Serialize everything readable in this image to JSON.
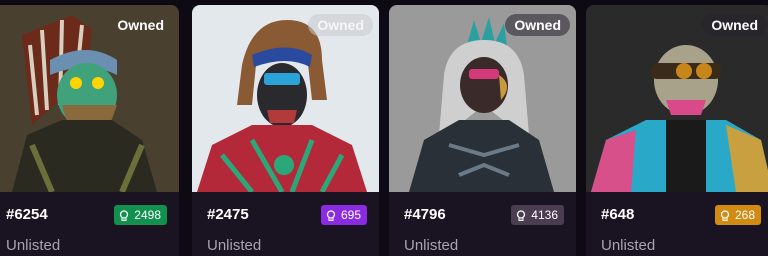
{
  "cards": [
    {
      "owned_label": "Owned",
      "id": "#6254",
      "rank": "2498",
      "rank_color": "#11904e",
      "status": "Unlisted"
    },
    {
      "owned_label": "Owned",
      "id": "#2475",
      "rank": "695",
      "rank_color": "#8a2be2",
      "status": "Unlisted"
    },
    {
      "owned_label": "Owned",
      "id": "#4796",
      "rank": "4136",
      "rank_color": "#4a3d52",
      "status": "Unlisted"
    },
    {
      "owned_label": "Owned",
      "id": "#648",
      "rank": "268",
      "rank_color": "#d18a12",
      "status": "Unlisted"
    }
  ]
}
